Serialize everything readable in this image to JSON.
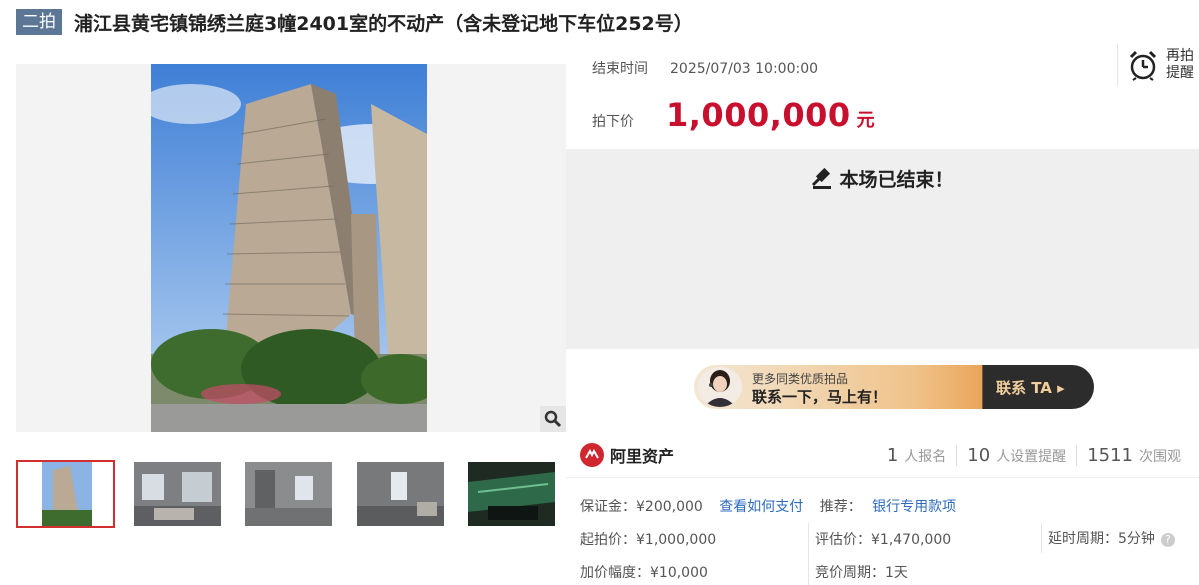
{
  "header": {
    "badge": "二拍",
    "title": "浦江县黄宅镇锦绣兰庭3幢2401室的不动产（含未登记地下车位252号）"
  },
  "auction": {
    "end_time_label": "结束时间",
    "end_time": "2025/07/03 10:00:00",
    "price_label": "拍下价",
    "price": "1,000,000",
    "price_unit": "元",
    "remind_line1": "再拍",
    "remind_line2": "提醒",
    "ended_message": "本场已结束！"
  },
  "promo": {
    "line1": "更多同类优质拍品",
    "line2": "联系一下，马上有！",
    "cta": "联系 TA ▸"
  },
  "platform": {
    "name": "阿里资产"
  },
  "stats": [
    {
      "value": "1",
      "label": "人报名"
    },
    {
      "value": "10",
      "label": "人设置提醒"
    },
    {
      "value": "1511",
      "label": "次围观"
    }
  ],
  "details": {
    "deposit": "保证金：¥200,000",
    "deposit_link": "查看如何支付",
    "recommend_label": "推荐：",
    "recommend_link": "银行专用款项",
    "start_price": "起拍价：¥1,000,000",
    "appraisal": "评估价：¥1,470,000",
    "delay": "延时周期：5分钟",
    "increment": "加价幅度：¥10,000",
    "bid_cycle": "竞价周期：1天"
  },
  "colors": {
    "accent": "#c8102e",
    "badge": "#5c7796",
    "link": "#2d6bbf"
  }
}
